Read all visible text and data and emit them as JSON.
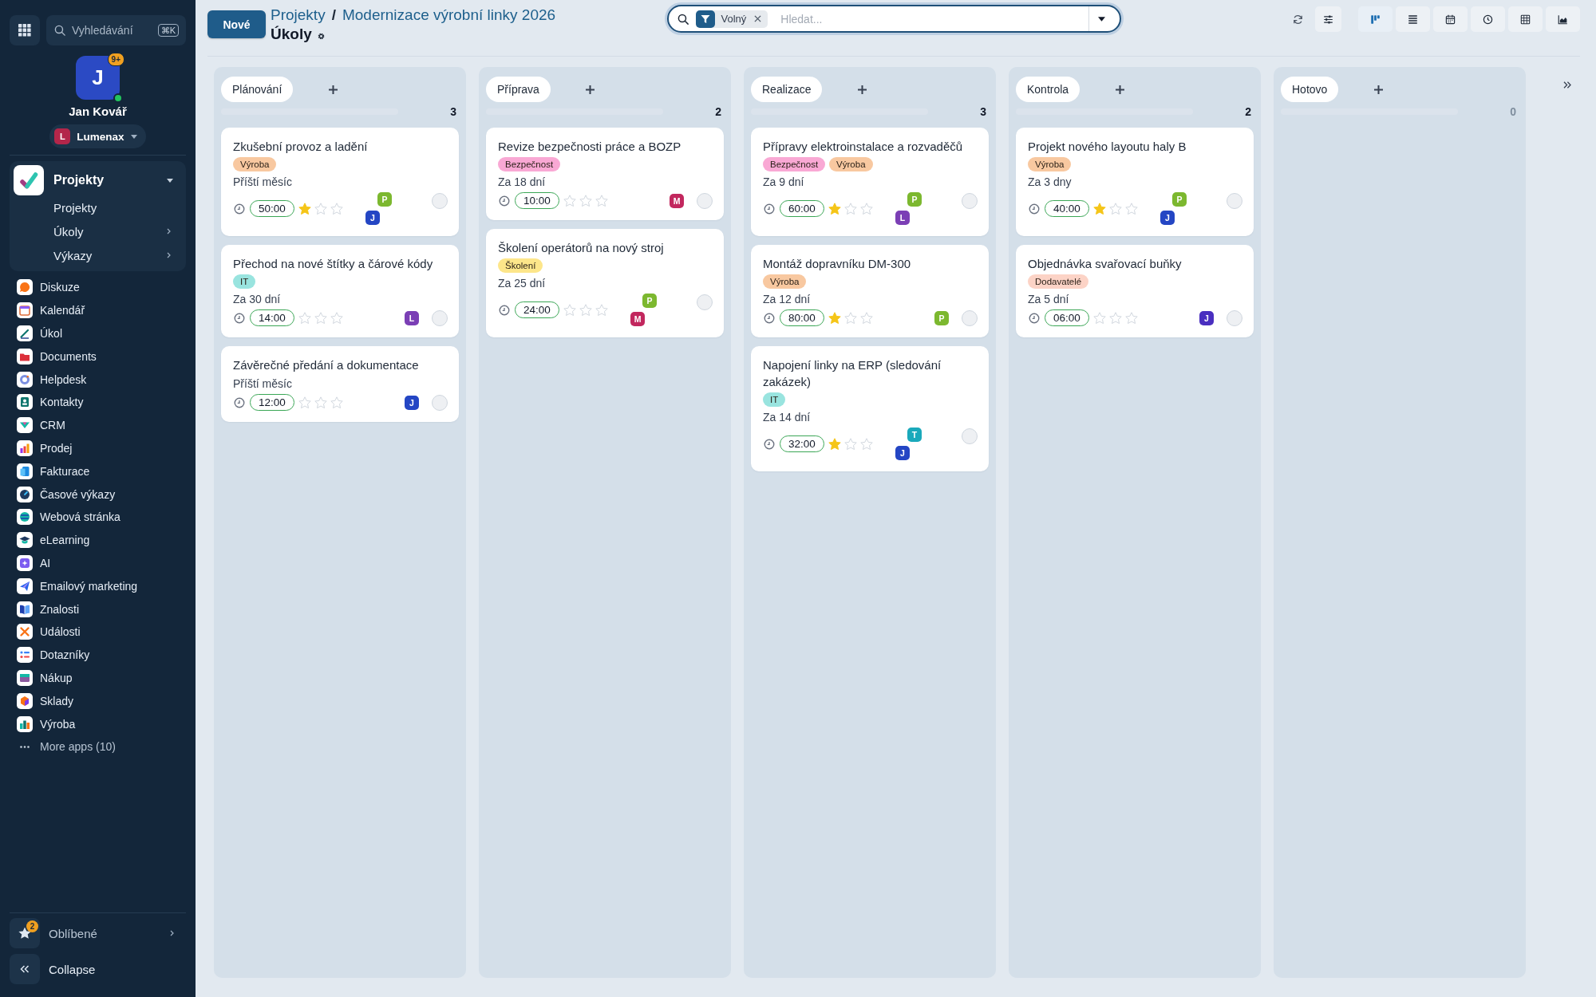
{
  "sidebar": {
    "search": {
      "placeholder": "Vyhledávání",
      "shortcut": "⌘K"
    },
    "user": {
      "initial": "J",
      "badge": "9+",
      "online": true,
      "name": "Jan Kovář"
    },
    "company": {
      "initial": "L",
      "name": "Lumenax"
    },
    "app_section": {
      "title": "Projekty",
      "expanded": true,
      "items": [
        {
          "label": "Projekty",
          "has_submenu": false
        },
        {
          "label": "Úkoly",
          "has_submenu": true
        },
        {
          "label": "Výkazy",
          "has_submenu": true
        }
      ]
    },
    "apps": [
      "Diskuze",
      "Kalendář",
      "Úkol",
      "Documents",
      "Helpdesk",
      "Kontakty",
      "CRM",
      "Prodej",
      "Fakturace",
      "Časové výkazy",
      "Webová stránka",
      "eLearning",
      "AI",
      "Emailový marketing",
      "Znalosti",
      "Události",
      "Dotazníky",
      "Nákup",
      "Sklady",
      "Výroba"
    ],
    "more_apps": "More apps (10)",
    "favorites": {
      "label": "Oblíbené",
      "badge": "2"
    },
    "collapse": {
      "label": "Collapse"
    }
  },
  "header": {
    "new_button": "Nové",
    "breadcrumb": [
      "Projekty",
      "Modernizace výrobní linky 2026"
    ],
    "separator": "/",
    "title": "Úkoly",
    "search": {
      "filter": "Volný",
      "placeholder": "Hledat..."
    },
    "views": [
      {
        "selected": true
      },
      {
        "selected": false
      },
      {
        "selected": false
      },
      {
        "selected": false
      },
      {
        "selected": false
      },
      {
        "selected": false
      }
    ]
  },
  "board": {
    "columns": [
      {
        "name": "Plánování",
        "count": "3",
        "level": 0,
        "cards": [
          {
            "title": "Zkušební provoz a ladění",
            "tags": [
              {
                "label": "Výroba",
                "color": "#f8c8a0"
              }
            ],
            "due": "Příští měsíc",
            "time": "50:00",
            "stars": 1,
            "assignees": [
              {
                "initial": "P",
                "color": "#7cb82f"
              },
              {
                "initial": "J",
                "color": "#2446c4"
              }
            ],
            "checked": false
          },
          {
            "title": "Přechod na nové štítky a čárové kódy",
            "tags": [
              {
                "label": "IT",
                "color": "#99e4df"
              }
            ],
            "due": "Za 30 dní",
            "time": "14:00",
            "stars": 0,
            "assignees": [
              {
                "initial": "L",
                "color": "#7b3fb5"
              }
            ],
            "checked": false
          },
          {
            "title": "Závěrečné předání a dokumentace",
            "due": "Příští měsíc",
            "time": "12:00",
            "stars": 0,
            "assignees": [
              {
                "initial": "J",
                "color": "#2446c4"
              }
            ],
            "checked": false
          }
        ]
      },
      {
        "name": "Příprava",
        "count": "2",
        "level": 0,
        "cards": [
          {
            "title": "Revize bezpečnosti práce a BOZP",
            "tags": [
              {
                "label": "Bezpečnost",
                "color": "#f9a8d4"
              }
            ],
            "due": "Za 18 dní",
            "time": "10:00",
            "stars": 0,
            "assignees": [
              {
                "initial": "M",
                "color": "#c2275e"
              }
            ],
            "checked": false
          },
          {
            "title": "Školení operátorů na nový stroj",
            "tags": [
              {
                "label": "Školení",
                "color": "#fde68a"
              }
            ],
            "due": "Za 25 dní",
            "time": "24:00",
            "stars": 0,
            "assignees": [
              {
                "initial": "P",
                "color": "#7cb82f"
              },
              {
                "initial": "M",
                "color": "#c2275e"
              }
            ],
            "checked": false
          }
        ]
      },
      {
        "name": "Realizace",
        "count": "3",
        "level": 0,
        "cards": [
          {
            "title": "Přípravy elektroinstalace a rozvaděčů",
            "tags": [
              {
                "label": "Bezpečnost",
                "color": "#f9a8d4"
              },
              {
                "label": "Výroba",
                "color": "#f8c8a0"
              }
            ],
            "due": "Za 9 dní",
            "time": "60:00",
            "stars": 1,
            "assignees": [
              {
                "initial": "P",
                "color": "#7cb82f"
              },
              {
                "initial": "L",
                "color": "#7b3fb5"
              }
            ],
            "checked": false
          },
          {
            "title": "Montáž dopravníku DM-300",
            "tags": [
              {
                "label": "Výroba",
                "color": "#f8c8a0"
              }
            ],
            "due": "Za 12 dní",
            "time": "80:00",
            "stars": 1,
            "assignees": [
              {
                "initial": "P",
                "color": "#7cb82f"
              }
            ],
            "checked": false
          },
          {
            "title": "Napojení linky na ERP (sledování zakázek)",
            "tags": [
              {
                "label": "IT",
                "color": "#99e4df"
              }
            ],
            "due": "Za 14 dní",
            "time": "32:00",
            "stars": 1,
            "assignees": [
              {
                "initial": "T",
                "color": "#1aa9bb"
              },
              {
                "initial": "J",
                "color": "#2446c4"
              }
            ],
            "checked": false
          }
        ]
      },
      {
        "name": "Kontrola",
        "count": "2",
        "level": 0,
        "cards": [
          {
            "title": "Projekt nového layoutu haly B",
            "tags": [
              {
                "label": "Výroba",
                "color": "#f8c8a0"
              }
            ],
            "due": "Za 3 dny",
            "time": "40:00",
            "stars": 1,
            "assignees": [
              {
                "initial": "P",
                "color": "#7cb82f"
              },
              {
                "initial": "J",
                "color": "#2446c4"
              }
            ],
            "checked": false
          },
          {
            "title": "Objednávka svařovací buňky",
            "tags": [
              {
                "label": "Dodavatelé",
                "color": "#fcd3c6"
              }
            ],
            "due": "Za 5 dní",
            "time": "06:00",
            "stars": 0,
            "assignees": [
              {
                "initial": "J",
                "color": "#4a2fc0"
              }
            ],
            "checked": false
          }
        ]
      },
      {
        "name": "Hotovo",
        "count": "0",
        "level": 0
      }
    ]
  }
}
